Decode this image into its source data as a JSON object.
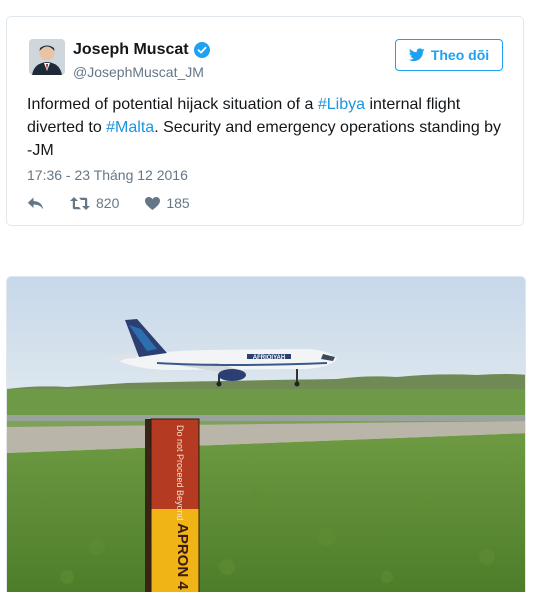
{
  "tweet": {
    "display_name": "Joseph Muscat",
    "handle": "@JosephMuscat_JM",
    "follow_label": "Theo dõi",
    "text_parts": [
      "Informed of potential hijack situation of a ",
      "#Libya",
      " internal flight diverted to ",
      "#Malta",
      ". Security and emergency operations standing by -JM"
    ],
    "timestamp": "17:36 - 23 Tháng 12 2016",
    "retweet_count": "820",
    "like_count": "185"
  },
  "photo": {
    "aircraft_livery": "AFRIQIYAH",
    "sign_text_top": "Do not Proceed Beyond",
    "sign_text_bottom": "APRON 4"
  },
  "colors": {
    "accent": "#1da1f2",
    "link": "#1b95e0",
    "muted": "#657786"
  }
}
